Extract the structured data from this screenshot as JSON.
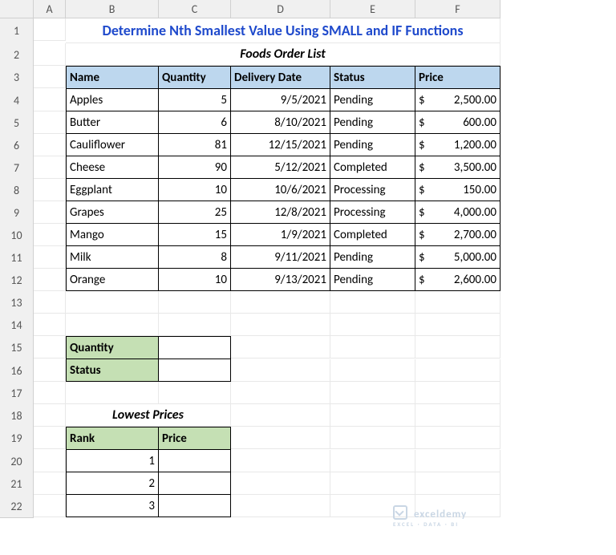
{
  "columns": [
    "",
    "A",
    "B",
    "C",
    "D",
    "E",
    "F"
  ],
  "rows": [
    "1",
    "2",
    "3",
    "4",
    "5",
    "6",
    "7",
    "8",
    "9",
    "10",
    "11",
    "12",
    "13",
    "14",
    "15",
    "16",
    "17",
    "18",
    "19",
    "20",
    "21",
    "22"
  ],
  "title": "Determine Nth Smallest Value Using SMALL and IF Functions",
  "subtitle": "Foods Order List",
  "table": {
    "headers": [
      "Name",
      "Quantity",
      "Delivery Date",
      "Status",
      "Price"
    ],
    "rows": [
      {
        "name": "Apples",
        "qty": "5",
        "date": "9/5/2021",
        "status": "Pending",
        "price": "2,500.00"
      },
      {
        "name": "Butter",
        "qty": "6",
        "date": "8/10/2021",
        "status": "Pending",
        "price": "   600.00"
      },
      {
        "name": "Cauliflower",
        "qty": "81",
        "date": "12/15/2021",
        "status": "Pending",
        "price": "1,200.00"
      },
      {
        "name": "Cheese",
        "qty": "90",
        "date": "5/12/2021",
        "status": "Completed",
        "price": "3,500.00"
      },
      {
        "name": "Eggplant",
        "qty": "10",
        "date": "10/6/2021",
        "status": "Processing",
        "price": "   150.00"
      },
      {
        "name": "Grapes",
        "qty": "25",
        "date": "12/8/2021",
        "status": "Processing",
        "price": "4,000.00"
      },
      {
        "name": "Mango",
        "qty": "15",
        "date": "1/9/2021",
        "status": "Completed",
        "price": "2,700.00"
      },
      {
        "name": "Milk",
        "qty": "8",
        "date": "9/11/2021",
        "status": "Pending",
        "price": "5,000.00"
      },
      {
        "name": "Orange",
        "qty": "10",
        "date": "9/13/2021",
        "status": "Pending",
        "price": "2,600.00"
      }
    ]
  },
  "criteria": {
    "quantity_label": "Quantity",
    "status_label": "Status"
  },
  "lowest": {
    "title": "Lowest Prices",
    "rank_label": "Rank",
    "price_label": "Price",
    "ranks": [
      "1",
      "2",
      "3"
    ]
  },
  "watermark": {
    "brand": "exceldemy",
    "tag": "EXCEL · DATA · BI"
  }
}
